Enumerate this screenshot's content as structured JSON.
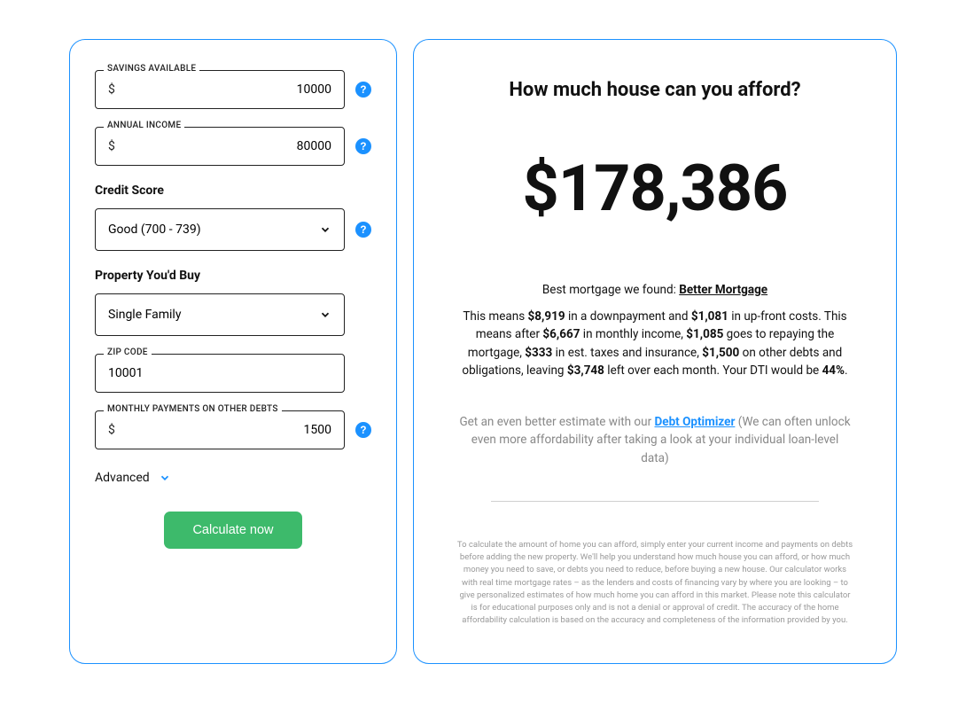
{
  "form": {
    "savings": {
      "label": "SAVINGS AVAILABLE",
      "prefix": "$",
      "value": "10000"
    },
    "income": {
      "label": "ANNUAL INCOME",
      "prefix": "$",
      "value": "80000"
    },
    "credit_score": {
      "label": "Credit Score",
      "selected": "Good (700 - 739)"
    },
    "property": {
      "label": "Property You'd Buy",
      "selected": "Single Family"
    },
    "zip": {
      "label": "ZIP CODE",
      "value": "10001"
    },
    "debts": {
      "label": "MONTHLY PAYMENTS ON OTHER DEBTS",
      "prefix": "$",
      "value": "1500"
    },
    "advanced_label": "Advanced",
    "calculate_label": "Calculate now"
  },
  "results": {
    "title": "How much house can you afford?",
    "amount": "$178,386",
    "best_mortgage_prefix": "Best mortgage we found: ",
    "best_mortgage_name": "Better Mortgage",
    "summary": {
      "p1": "This means ",
      "downpayment": "$8,919",
      "p2": " in a downpayment and ",
      "upfront": "$1,081",
      "p3": " in up-front costs. This means after ",
      "monthly_income": "$6,667",
      "p4": " in monthly income, ",
      "repay": "$1,085",
      "p5": " goes to repaying the mortgage, ",
      "taxes": "$333",
      "p6": " in est. taxes and insurance, ",
      "other_debts": "$1,500",
      "p7": " on other debts and obligations, leaving ",
      "leftover": "$3,748",
      "p8": " left over each month. Your DTI would be ",
      "dti": "44%",
      "p9": "."
    },
    "optimizer": {
      "prefix": "Get an even better estimate with our ",
      "link": "Debt Optimizer",
      "suffix": " (We can often unlock even more affordability after taking a look at your individual loan-level data)"
    },
    "disclaimer": "To calculate the amount of home you can afford, simply enter your current income and payments on debts before adding the new property. We'll help you understand how much house you can afford, or how much money you need to save, or debts you need to reduce, before buying a new house. Our calculator works with real time mortgage rates – as the lenders and costs of financing vary by where you are looking – to give personalized estimates of how much home you can afford in this market. Please note this calculator is for educational purposes only and is not a denial or approval of credit. The accuracy of the home affordability calculation is based on the accuracy and completeness of the information provided by you."
  }
}
